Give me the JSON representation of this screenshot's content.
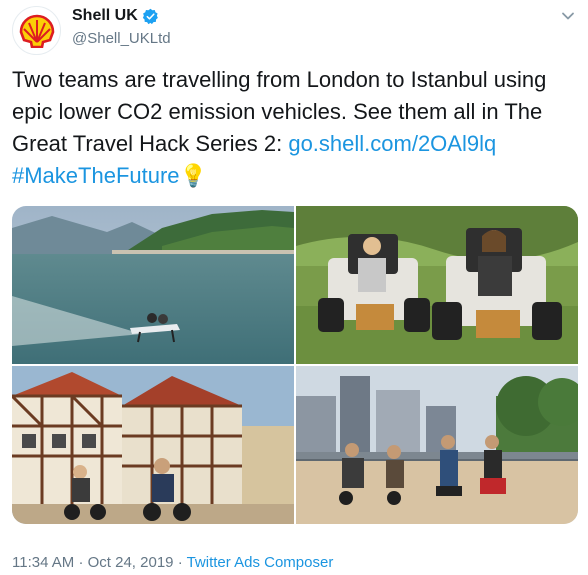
{
  "account": {
    "display_name": "Shell UK",
    "handle": "@Shell_UKLtd",
    "verified": true,
    "avatar_icon": "shell-logo-icon"
  },
  "tweet": {
    "text": "Two teams are travelling from London to Istanbul using epic lower CO2 emission vehicles. See them all in The Great Travel Hack Series 2: ",
    "link": "go.shell.com/2OAl9lq",
    "hashtag": "#MakeTheFuture",
    "emoji": "💡"
  },
  "media": {
    "tiles": [
      {
        "name": "lake-hydrofoil-photo"
      },
      {
        "name": "off-road-wheelchairs-photo"
      },
      {
        "name": "village-scooters-photo"
      },
      {
        "name": "city-bridge-rides-photo"
      }
    ]
  },
  "meta": {
    "time": "11:34 AM",
    "separator": "·",
    "date": "Oct 24, 2019",
    "source": "Twitter Ads Composer"
  },
  "colors": {
    "link": "#1b95e0",
    "verified": "#1da1f2",
    "secondary_text": "#657786",
    "shell_red": "#dd1d21",
    "shell_yellow": "#fbce07"
  }
}
